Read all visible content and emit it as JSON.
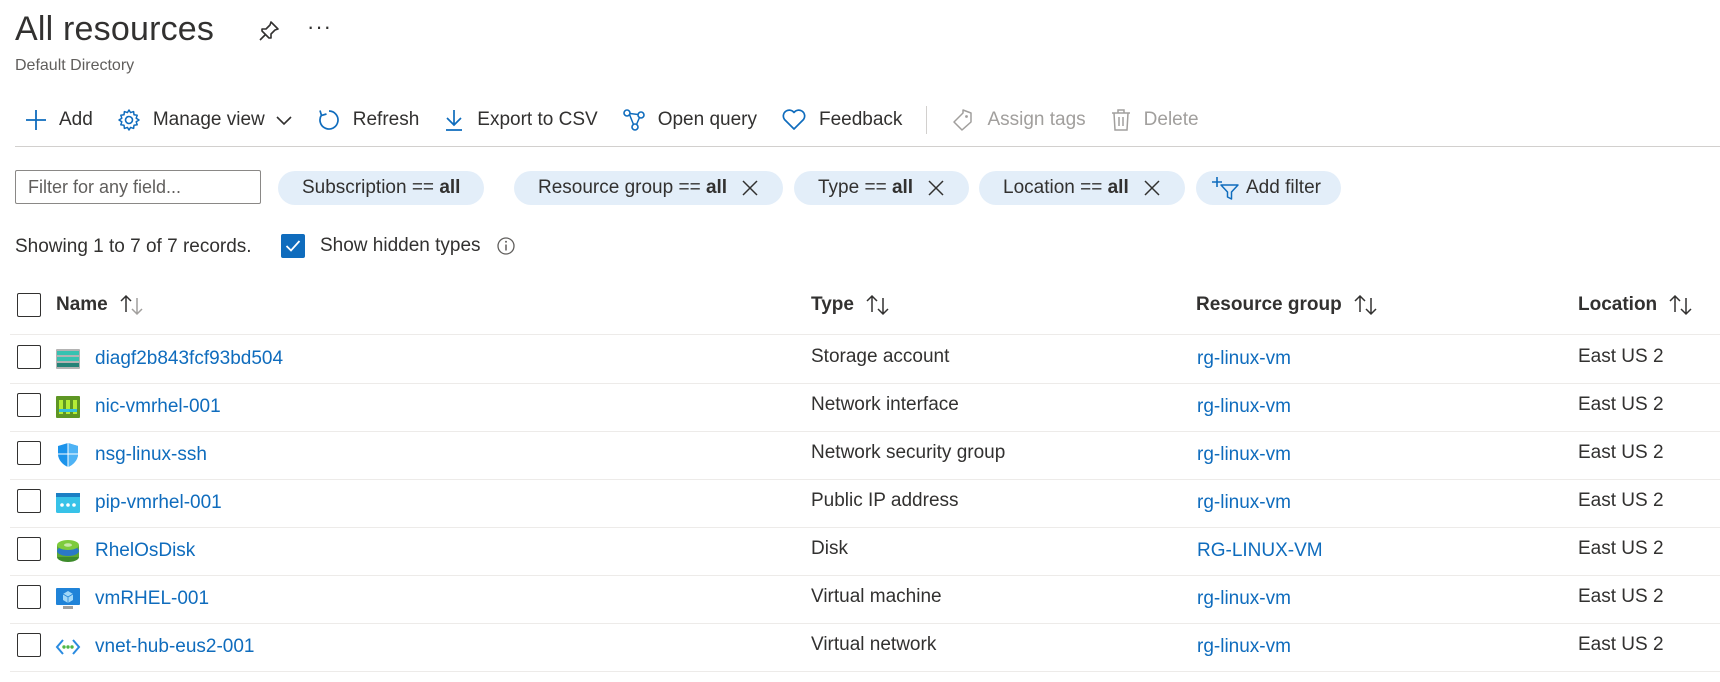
{
  "header": {
    "title": "All resources",
    "more_label": "···",
    "subtitle": "Default Directory"
  },
  "toolbar": {
    "add": "Add",
    "manage_view": "Manage view",
    "refresh": "Refresh",
    "export_csv": "Export to CSV",
    "open_query": "Open query",
    "feedback": "Feedback",
    "assign_tags": "Assign tags",
    "delete": "Delete"
  },
  "filters": {
    "placeholder": "Filter for any field...",
    "pills": [
      {
        "key": "Subscription ==",
        "value": "all"
      },
      {
        "key": "Resource group ==",
        "value": "all"
      },
      {
        "key": "Type ==",
        "value": "all"
      },
      {
        "key": "Location ==",
        "value": "all"
      }
    ],
    "add_filter": "Add filter"
  },
  "status": {
    "showing": "Showing 1 to 7 of 7 records.",
    "show_hidden_types": "Show hidden types",
    "show_hidden_checked": true
  },
  "table": {
    "columns": {
      "name": "Name",
      "type": "Type",
      "resource_group": "Resource group",
      "location": "Location"
    },
    "rows": [
      {
        "name": "diagf2b843fcf93bd504",
        "type": "Storage account",
        "resource_group": "rg-linux-vm",
        "location": "East US 2",
        "icon": "storage-account-icon"
      },
      {
        "name": "nic-vmrhel-001",
        "type": "Network interface",
        "resource_group": "rg-linux-vm",
        "location": "East US 2",
        "icon": "network-interface-icon"
      },
      {
        "name": "nsg-linux-ssh",
        "type": "Network security group",
        "resource_group": "rg-linux-vm",
        "location": "East US 2",
        "icon": "network-security-group-icon"
      },
      {
        "name": "pip-vmrhel-001",
        "type": "Public IP address",
        "resource_group": "rg-linux-vm",
        "location": "East US 2",
        "icon": "public-ip-icon"
      },
      {
        "name": "RhelOsDisk",
        "type": "Disk",
        "resource_group": "RG-LINUX-VM",
        "location": "East US 2",
        "icon": "disk-icon"
      },
      {
        "name": "vmRHEL-001",
        "type": "Virtual machine",
        "resource_group": "rg-linux-vm",
        "location": "East US 2",
        "icon": "virtual-machine-icon"
      },
      {
        "name": "vnet-hub-eus2-001",
        "type": "Virtual network",
        "resource_group": "rg-linux-vm",
        "location": "East US 2",
        "icon": "virtual-network-icon"
      }
    ]
  },
  "colors": {
    "accent": "#0f6cbd",
    "pill_bg": "#e3eef9",
    "text": "#323130",
    "disabled": "#a19f9d"
  }
}
